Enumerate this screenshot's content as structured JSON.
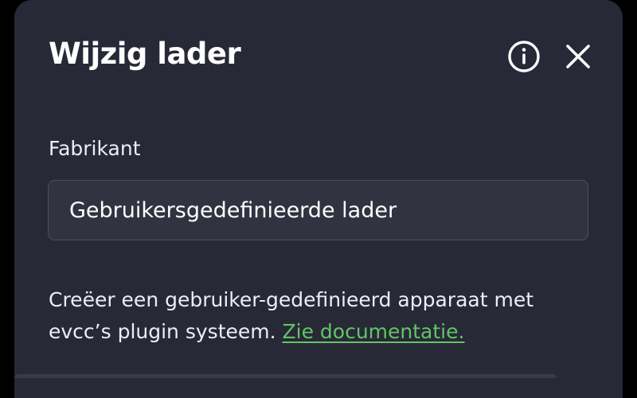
{
  "modal": {
    "title": "Wijzig lader",
    "info_icon": "info-circle-icon",
    "close_icon": "close-x-icon"
  },
  "form": {
    "manufacturer_label": "Fabrikant",
    "manufacturer_value": "Gebruikersgedefinieerde lader"
  },
  "help": {
    "text": "Creëer een gebruiker-gedefinieerd apparaat met evcc’s plugin systeem.",
    "link_text": "Zie documentatie."
  },
  "colors": {
    "background": "#000000",
    "modal_bg": "#282937",
    "input_bg": "#323341",
    "input_border": "#4c4e5d",
    "text": "#ffffff",
    "link": "#61c565"
  }
}
